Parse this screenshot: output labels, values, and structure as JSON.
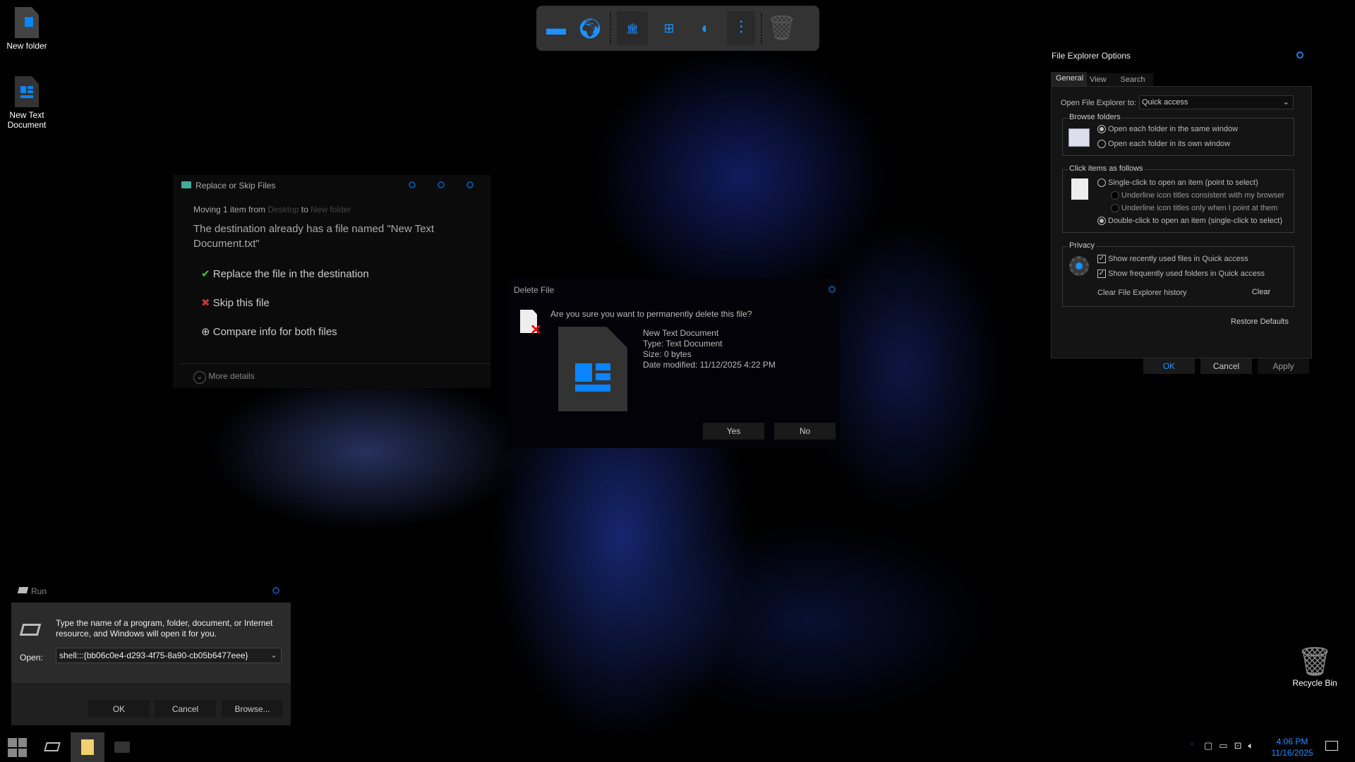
{
  "desktop": {
    "icons": [
      {
        "label": "New folder"
      },
      {
        "label": "New Text Document"
      }
    ],
    "recycle_bin": "Recycle Bin"
  },
  "toolbar": {
    "items": [
      "monitor-icon",
      "globe-icon",
      "folder-bank-icon",
      "windows-drive-icon",
      "toggle-icon",
      "equalizer-icon",
      "trash-icon"
    ]
  },
  "replace_dialog": {
    "title": "Replace or Skip Files",
    "moving_prefix": "Moving 1 item from",
    "from": "Desktop",
    "to_word": "to",
    "to": "New folder",
    "message": "The destination already has a file named \"New Text Document.txt\"",
    "options": [
      "Replace the file in the destination",
      "Skip this file",
      "Compare info for both files"
    ],
    "more_details": "More details"
  },
  "delete_dialog": {
    "title": "Delete File",
    "question": "Are you sure you want to permanently delete this file?",
    "file_name": "New Text Document",
    "type": "Type: Text Document",
    "size": "Size: 0 bytes",
    "modified": "Date modified: 11/12/2025 4:22 PM",
    "yes": "Yes",
    "no": "No"
  },
  "options_dialog": {
    "title": "File Explorer Options",
    "tabs": [
      "General",
      "View",
      "Search"
    ],
    "active_tab": "General",
    "open_to_label": "Open File Explorer to:",
    "open_to_value": "Quick access",
    "browse": {
      "legend": "Browse folders",
      "options": [
        "Open each folder in the same window",
        "Open each folder in its own window"
      ],
      "selected": 0
    },
    "click": {
      "legend": "Click items as follows",
      "single": "Single-click to open an item (point to select)",
      "sub": [
        "Underline icon titles consistent with my browser",
        "Underline icon titles only when I point at them"
      ],
      "double": "Double-click to open an item (single-click to select)",
      "selected": "double"
    },
    "privacy": {
      "legend": "Privacy",
      "checks": [
        {
          "label": "Show recently used files in Quick access",
          "checked": true
        },
        {
          "label": "Show frequently used folders in Quick access",
          "checked": true
        }
      ],
      "clear_label": "Clear File Explorer history",
      "clear_btn": "Clear"
    },
    "restore": "Restore Defaults",
    "ok": "OK",
    "cancel": "Cancel",
    "apply": "Apply"
  },
  "run_dialog": {
    "title": "Run",
    "description": "Type the name of a program, folder, document, or Internet resource, and Windows will open it for you.",
    "open_label": "Open:",
    "open_value": "shell:::{bb06c0e4-d293-4f75-8a90-cb05b6477eee}",
    "ok": "OK",
    "cancel": "Cancel",
    "browse": "Browse..."
  },
  "taskbar": {
    "time": "4:06 PM",
    "date": "11/16/2025",
    "accent": "#1e90ff"
  }
}
